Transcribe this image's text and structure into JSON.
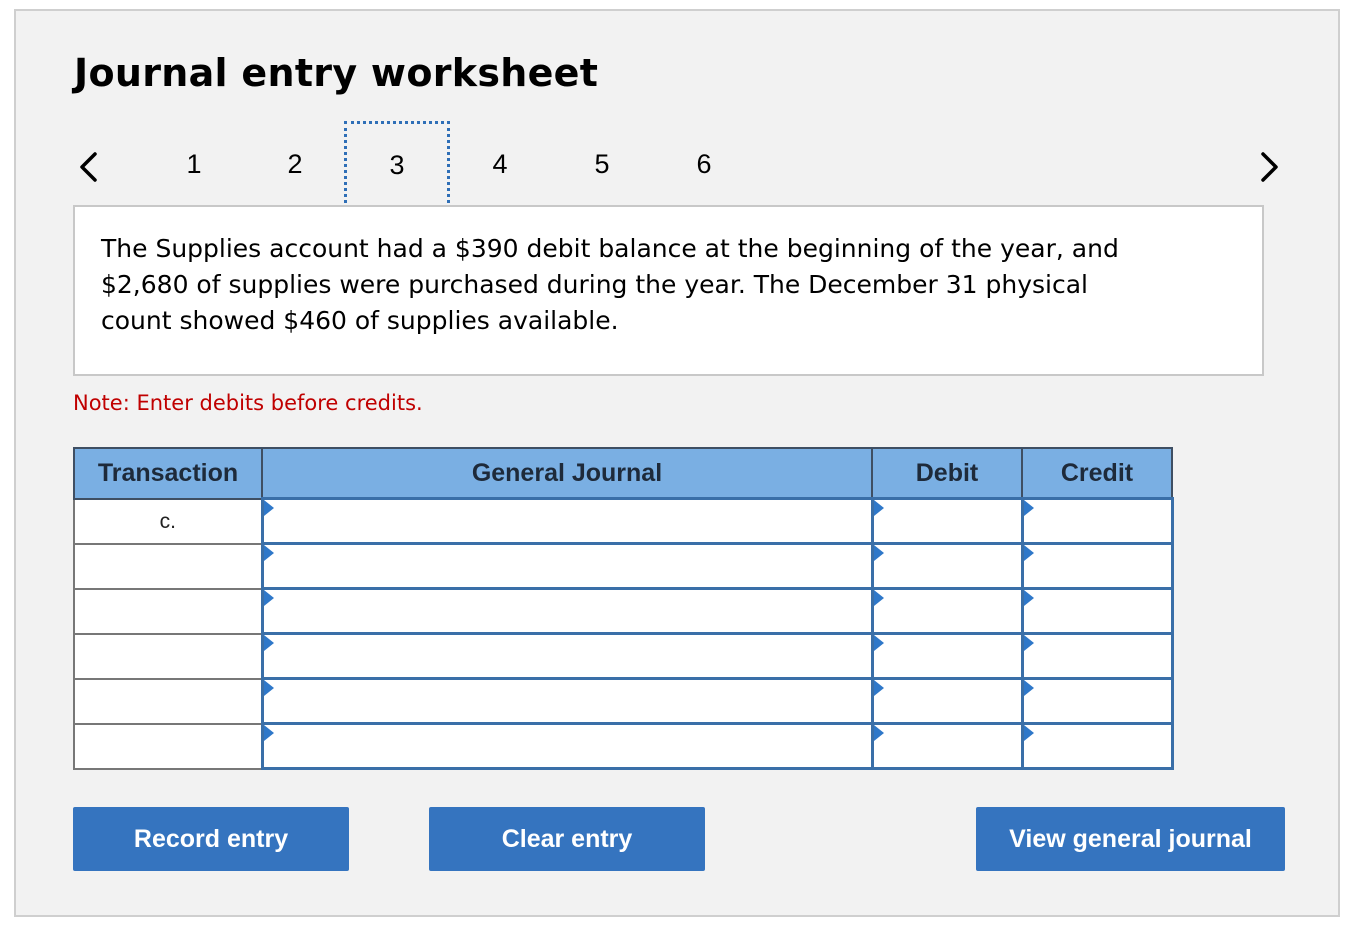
{
  "header": {
    "title": "Journal entry worksheet"
  },
  "pager": {
    "pages": [
      "1",
      "2",
      "3",
      "4",
      "5",
      "6"
    ],
    "current": "3"
  },
  "scenario": {
    "text": "The Supplies account had a $390 debit balance at the beginning of the year, and $2,680 of supplies were purchased during the year. The December 31 physical count showed $460 of supplies available."
  },
  "note": "Note: Enter debits before credits.",
  "table": {
    "headers": {
      "transaction": "Transaction",
      "general_journal": "General Journal",
      "debit": "Debit",
      "credit": "Credit"
    },
    "rows": [
      {
        "transaction": "c.",
        "account": "",
        "debit": "",
        "credit": ""
      },
      {
        "transaction": "",
        "account": "",
        "debit": "",
        "credit": ""
      },
      {
        "transaction": "",
        "account": "",
        "debit": "",
        "credit": ""
      },
      {
        "transaction": "",
        "account": "",
        "debit": "",
        "credit": ""
      },
      {
        "transaction": "",
        "account": "",
        "debit": "",
        "credit": ""
      },
      {
        "transaction": "",
        "account": "",
        "debit": "",
        "credit": ""
      }
    ]
  },
  "buttons": {
    "record": "Record entry",
    "clear": "Clear entry",
    "view": "View general journal"
  },
  "colors": {
    "panel_bg": "#f2f2f2",
    "header_bg": "#7aafe3",
    "button_bg": "#3574bf",
    "note_color": "#c00000",
    "focus_dots": "#2f6fb7"
  },
  "icons": {
    "prev": "chevron-left-icon",
    "next": "chevron-right-icon",
    "field_marker": "triangle-marker-icon"
  }
}
